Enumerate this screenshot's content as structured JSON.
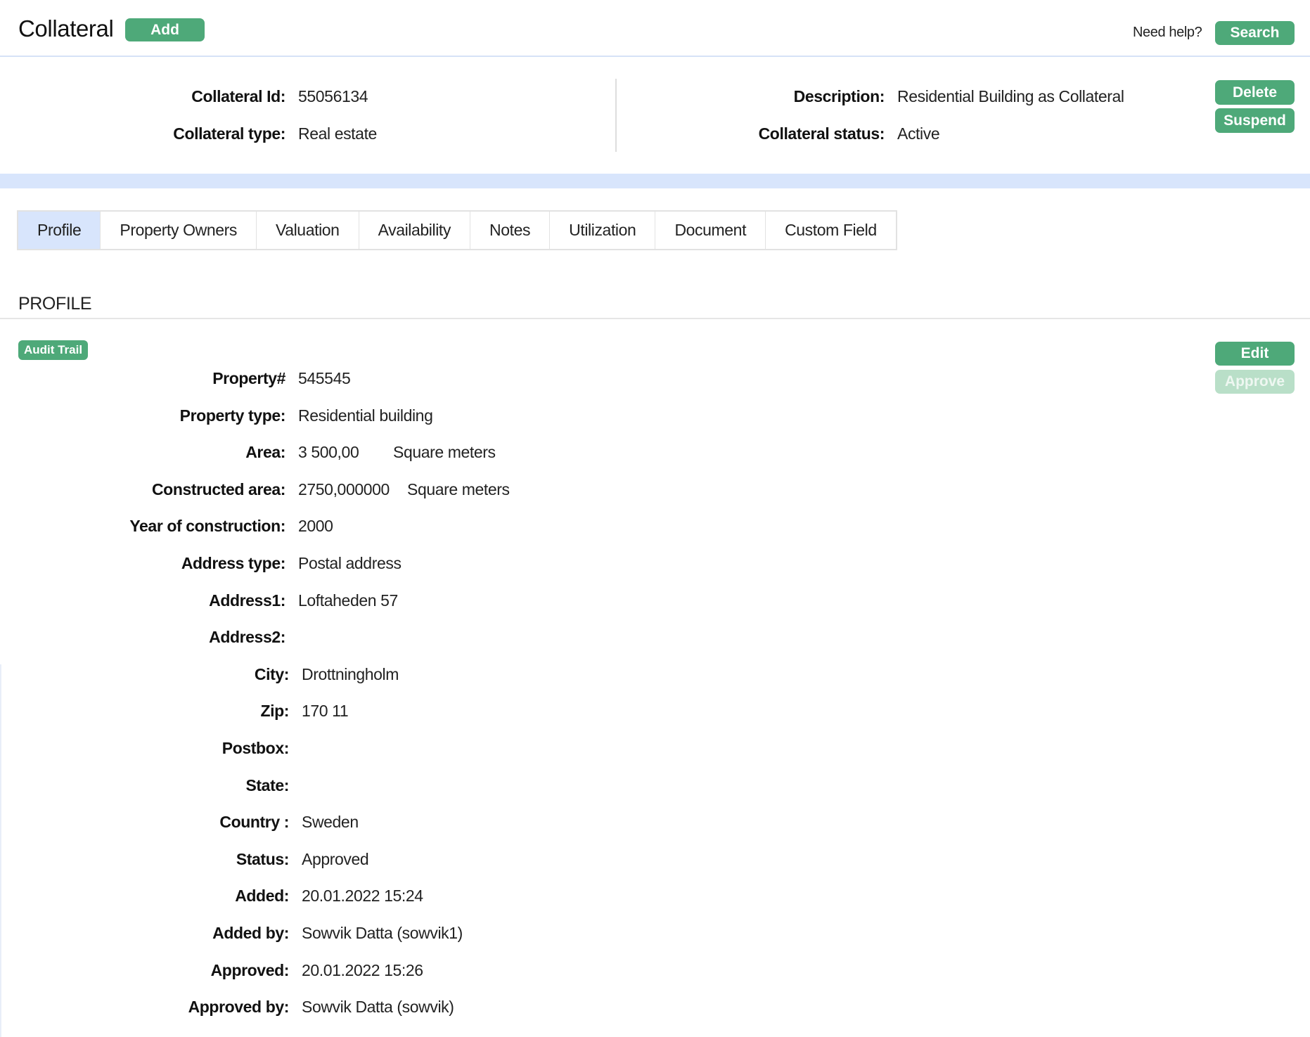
{
  "header": {
    "title": "Collateral",
    "add_label": "Add",
    "help_text": "Need help?",
    "search_label": "Search"
  },
  "summary": {
    "left": [
      {
        "label": "Collateral Id:",
        "value": "55056134"
      },
      {
        "label": "Collateral type:",
        "value": "Real estate"
      }
    ],
    "right": [
      {
        "label": "Description:",
        "value": "Residential Building as Collateral"
      },
      {
        "label": "Collateral status:",
        "value": "Active"
      }
    ],
    "delete_label": "Delete",
    "suspend_label": "Suspend"
  },
  "tabs": [
    "Profile",
    "Property Owners",
    "Valuation",
    "Availability",
    "Notes",
    "Utilization",
    "Document",
    "Custom Field"
  ],
  "profile": {
    "section_title": "PROFILE",
    "audit_label": "Audit Trail",
    "edit_label": "Edit",
    "approve_label": "Approve",
    "fields": [
      {
        "label": "Property#",
        "value": "545545"
      },
      {
        "label": "Property type:",
        "value": "Residential building"
      },
      {
        "label": "Area:",
        "value": "3 500,00",
        "unit": "Square meters"
      },
      {
        "label": "Constructed area:",
        "value": "2750,000000",
        "unit": "Square meters"
      },
      {
        "label": "Year of construction:",
        "value": "2000"
      },
      {
        "label": "Address type:",
        "value": "Postal address"
      },
      {
        "label": "Address1:",
        "value": "Loftaheden 57"
      },
      {
        "label": "Address2:",
        "value": ""
      },
      {
        "label": "City:",
        "value": "Drottningholm"
      },
      {
        "label": "Zip:",
        "value": "170 11"
      },
      {
        "label": "Postbox:",
        "value": ""
      },
      {
        "label": "State:",
        "value": ""
      },
      {
        "label": "Country :",
        "value": "Sweden"
      },
      {
        "label": "Status:",
        "value": "Approved"
      },
      {
        "label": "Added:",
        "value": "20.01.2022 15:24"
      },
      {
        "label": "Added by:",
        "value": "Sowvik Datta (sowvik1)"
      },
      {
        "label": "Approved:",
        "value": "20.01.2022 15:26"
      },
      {
        "label": "Approved by:",
        "value": "Sowvik Datta (sowvik)"
      }
    ]
  }
}
